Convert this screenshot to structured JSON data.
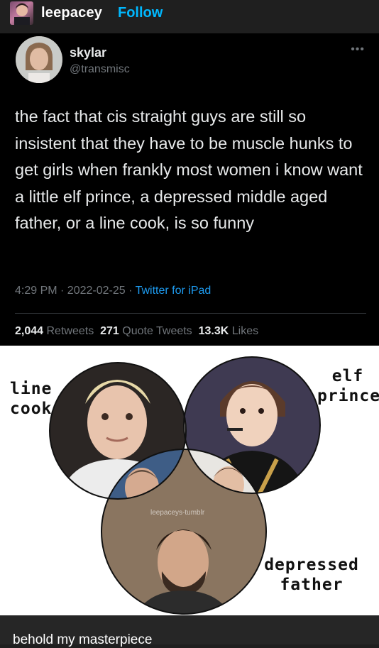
{
  "post": {
    "username": "leepacey",
    "follow_label": "Follow"
  },
  "tweet": {
    "name": "skylar",
    "handle": "@transmisc",
    "text": "the fact that cis straight guys are still so insistent that they have to be muscle hunks to get girls when frankly most women i know want a little elf prince, a depressed middle aged father, or a line cook, is so funny",
    "time": "4:29 PM · 2022-02-25 · ",
    "source": "Twitter for iPad",
    "retweets_count": "2,044",
    "retweets_label": "Retweets",
    "quotes_count": "271",
    "quotes_label": "Quote Tweets",
    "likes_count": "13.3K",
    "likes_label": "Likes"
  },
  "venn": {
    "label_line_cook_1": "line",
    "label_line_cook_2": "cook",
    "label_elf_1": "elf",
    "label_elf_2": "prince",
    "label_dep_1": "depressed",
    "label_dep_2": "father",
    "watermark": "leepaceys-tumblr"
  },
  "footer": {
    "caption": "behold my masterpiece"
  }
}
